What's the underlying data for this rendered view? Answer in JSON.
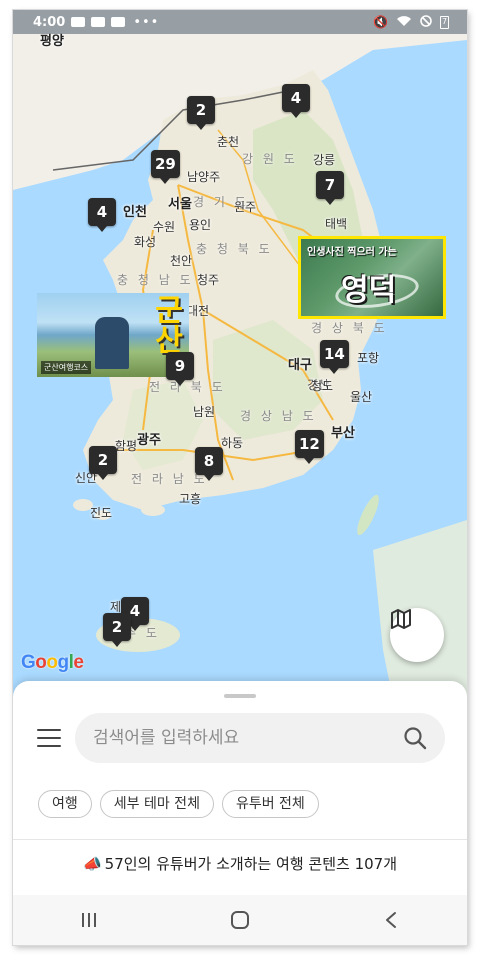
{
  "status_bar": {
    "time": "4:00",
    "battery": "7"
  },
  "map": {
    "cities": [
      {
        "id": "pyongyang",
        "name": "평양"
      },
      {
        "id": "chuncheon",
        "name": "춘천"
      },
      {
        "id": "gangneung",
        "name": "강릉"
      },
      {
        "id": "namyangju",
        "name": "남양주"
      },
      {
        "id": "wonju",
        "name": "원주"
      },
      {
        "id": "incheon",
        "name": "인천"
      },
      {
        "id": "seoul",
        "name": "서울"
      },
      {
        "id": "suwon",
        "name": "수원"
      },
      {
        "id": "yongin",
        "name": "용인"
      },
      {
        "id": "hwaseong",
        "name": "화성"
      },
      {
        "id": "taebaek",
        "name": "태백"
      },
      {
        "id": "cheonan",
        "name": "천안"
      },
      {
        "id": "cheongju",
        "name": "청주"
      },
      {
        "id": "daejeon",
        "name": "대전"
      },
      {
        "id": "daegu",
        "name": "대구"
      },
      {
        "id": "pohang",
        "name": "포항"
      },
      {
        "id": "gyeongsan",
        "name": "경산"
      },
      {
        "id": "cheongdo",
        "name": "청도"
      },
      {
        "id": "ulsan",
        "name": "울산"
      },
      {
        "id": "busan",
        "name": "부산"
      },
      {
        "id": "namwon",
        "name": "남원"
      },
      {
        "id": "gwangju",
        "name": "광주"
      },
      {
        "id": "hampyeong",
        "name": "함평"
      },
      {
        "id": "hadong",
        "name": "하동"
      },
      {
        "id": "sinan",
        "name": "신안"
      },
      {
        "id": "goheung",
        "name": "고흥"
      },
      {
        "id": "jindo",
        "name": "진도"
      },
      {
        "id": "jeju",
        "name": "제주"
      }
    ],
    "regions": [
      {
        "id": "gangwon",
        "name": "강 원 도"
      },
      {
        "id": "gyeonggi",
        "name": "경 기 도"
      },
      {
        "id": "chungbuk",
        "name": "충 청 북 도"
      },
      {
        "id": "chungnam",
        "name": "충 청 남 도"
      },
      {
        "id": "gyeongbuk",
        "name": "경 상 북 도"
      },
      {
        "id": "jeonbuk",
        "name": "전 라 북 도"
      },
      {
        "id": "gyeongnam",
        "name": "경 상 남 도"
      },
      {
        "id": "jeonnam",
        "name": "전 라 남 도"
      },
      {
        "id": "jejudo",
        "name": "주 도"
      }
    ],
    "markers": [
      {
        "id": "m1",
        "count": "2"
      },
      {
        "id": "m2",
        "count": "4"
      },
      {
        "id": "m3",
        "count": "29"
      },
      {
        "id": "m4",
        "count": "7"
      },
      {
        "id": "m5",
        "count": "4"
      },
      {
        "id": "m6",
        "count": "14"
      },
      {
        "id": "m7",
        "count": "9"
      },
      {
        "id": "m8",
        "count": "12"
      },
      {
        "id": "m9",
        "count": "2"
      },
      {
        "id": "m10",
        "count": "8"
      },
      {
        "id": "m11",
        "count": "4"
      },
      {
        "id": "m12",
        "count": "2"
      }
    ],
    "thumbnails": {
      "yeongdeok": {
        "subtitle": "인생사진 찍으러 가는",
        "title": "영덕"
      },
      "gunsan": {
        "title": "군산",
        "caption": "군산여행코스"
      }
    },
    "google_logo": [
      "G",
      "o",
      "o",
      "g",
      "l",
      "e"
    ],
    "colors": {
      "sea": "#aadaff",
      "land": "#f0ecdf",
      "marker": "#2b2b2b",
      "highlight": "#ffe600"
    }
  },
  "sheet": {
    "search": {
      "placeholder": "검색어를 입력하세요",
      "value": ""
    },
    "chips": [
      "여행",
      "세부 테마 전체",
      "유투버 전체"
    ],
    "promo_text": "57인의 유튜버가 소개하는 여행 콘텐츠 107개"
  },
  "icons": {
    "menu": "hamburger-menu-icon",
    "search": "search-icon",
    "map_toggle": "map-icon",
    "megaphone": "megaphone-icon",
    "recents": "recents-icon",
    "home": "home-icon",
    "back": "back-icon"
  }
}
